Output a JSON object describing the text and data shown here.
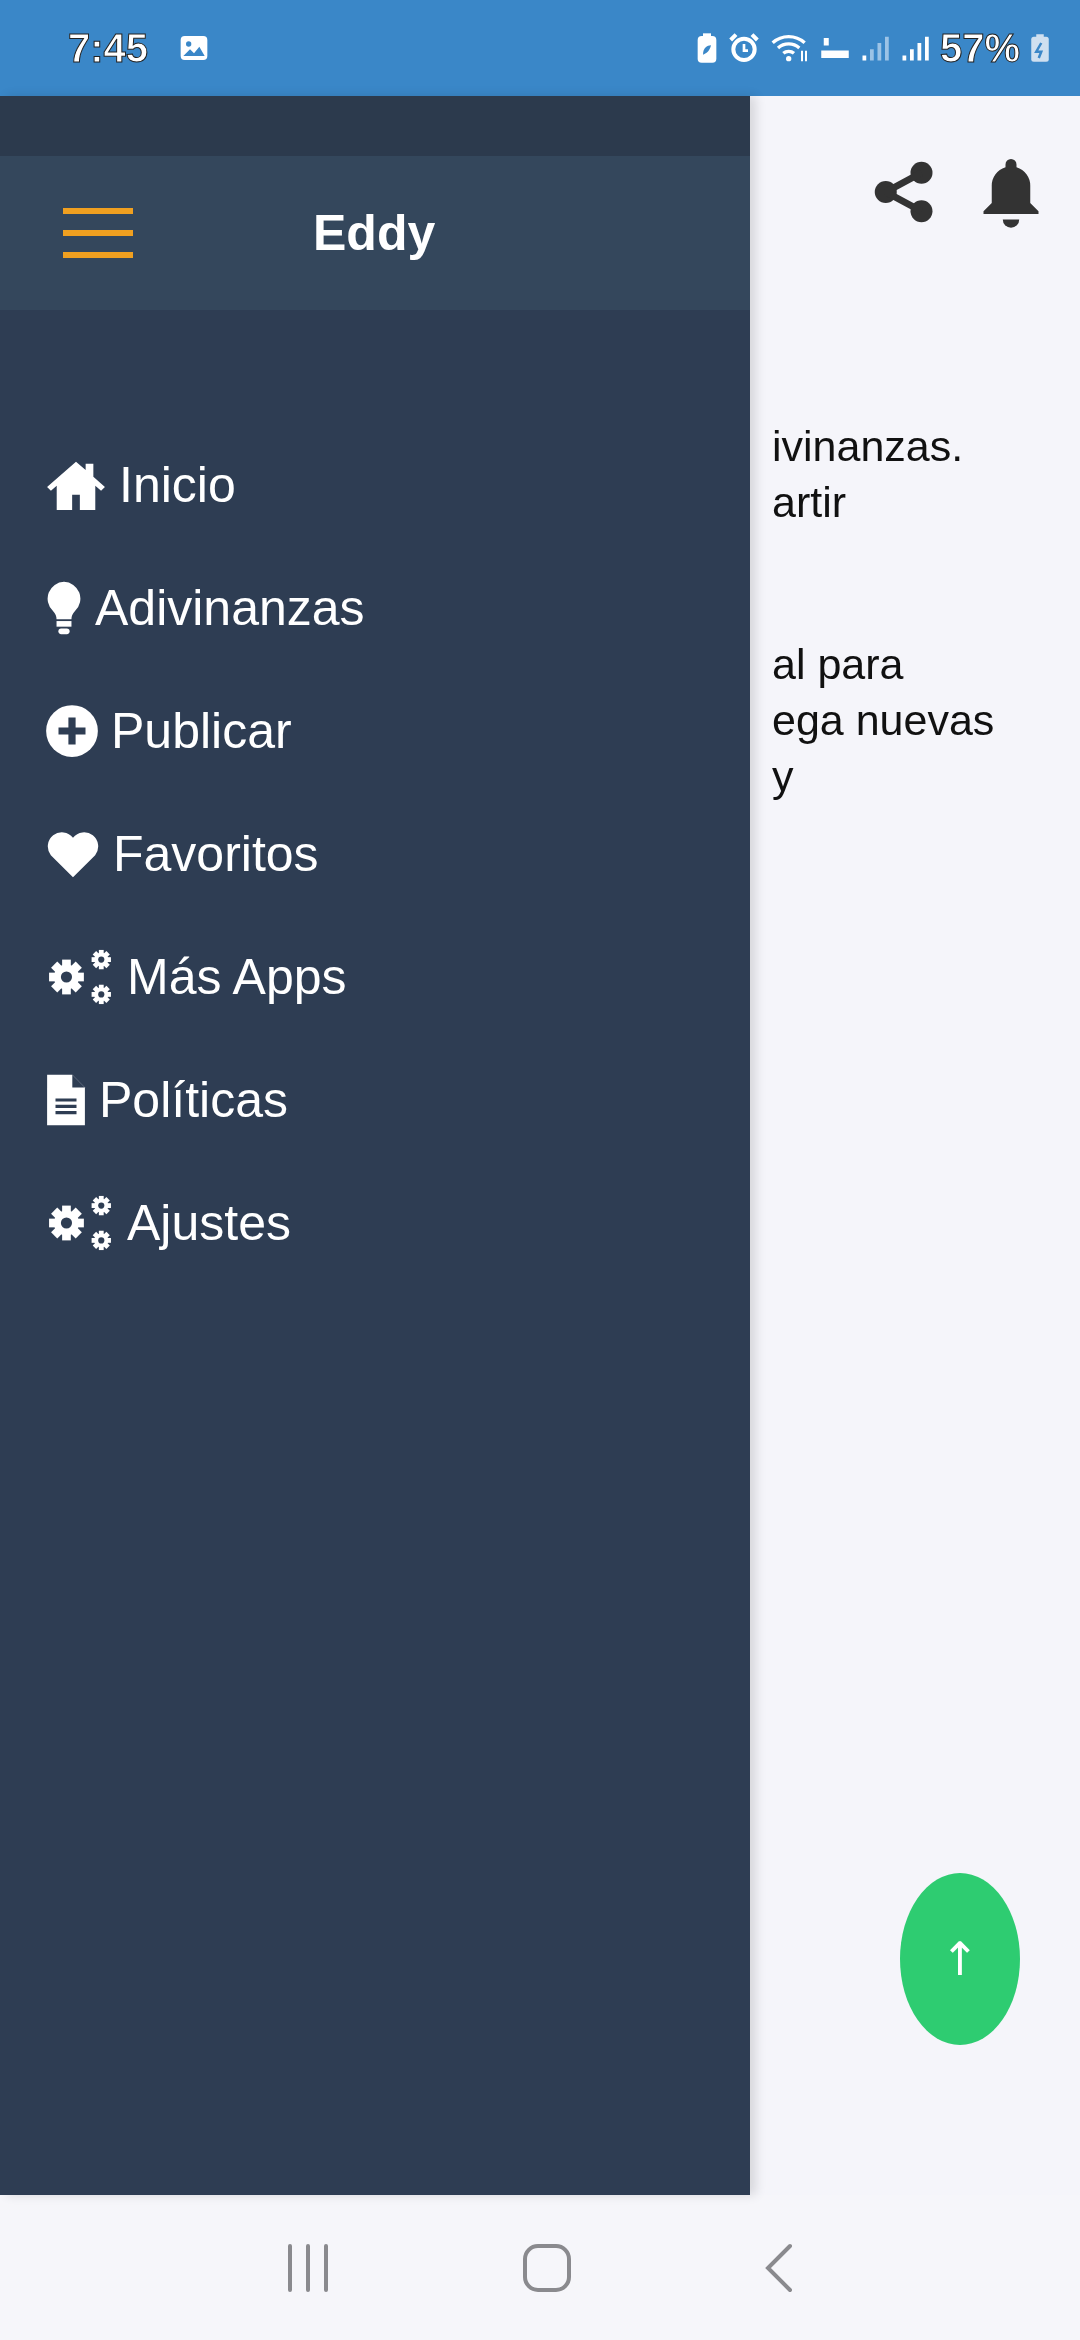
{
  "status_bar": {
    "time": "7:45",
    "battery": "57%"
  },
  "drawer": {
    "title": "Eddy",
    "items": [
      {
        "label": "Inicio"
      },
      {
        "label": "Adivinanzas"
      },
      {
        "label": "Publicar"
      },
      {
        "label": "Favoritos"
      },
      {
        "label": "Más Apps"
      },
      {
        "label": "Políticas"
      },
      {
        "label": "Ajustes"
      }
    ]
  },
  "content": {
    "paragraphs": [
      [
        "ivinanzas.",
        "artir"
      ],
      [
        "al para",
        "ega nuevas",
        "y"
      ]
    ]
  },
  "fab": {
    "label": "↑"
  }
}
